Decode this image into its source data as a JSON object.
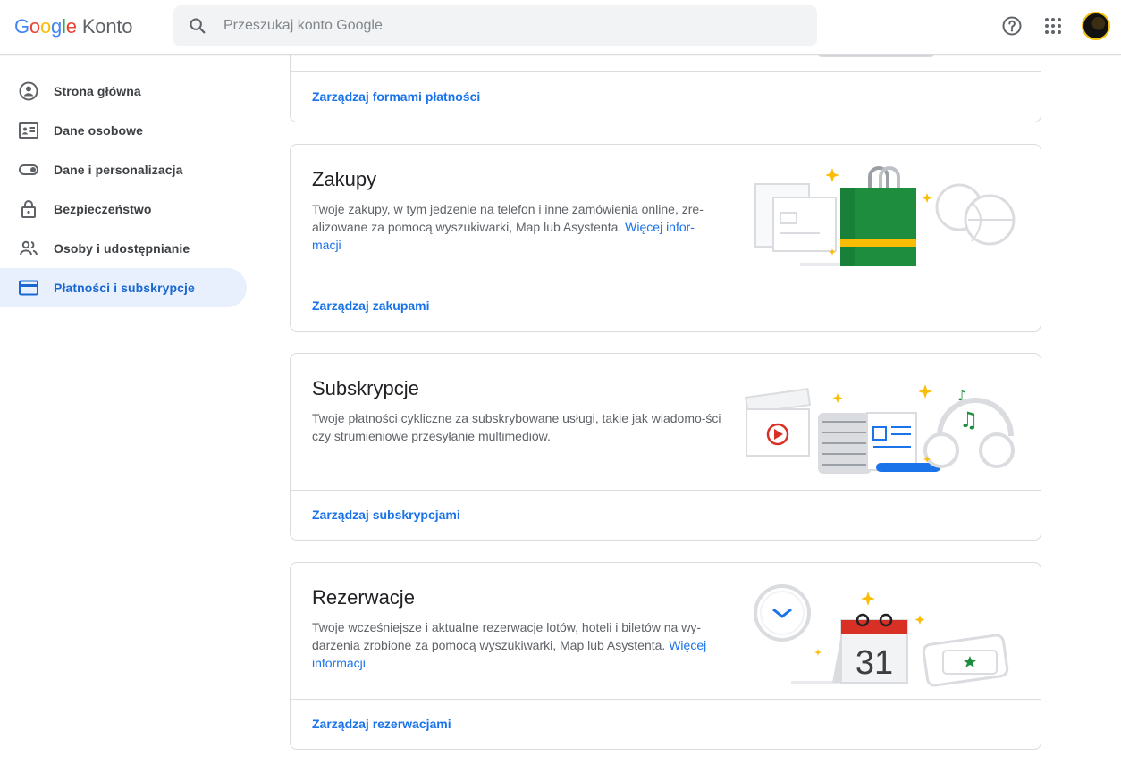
{
  "header": {
    "logo_letters": [
      "G",
      "o",
      "o",
      "g",
      "l",
      "e"
    ],
    "logo_suffix": "Konto",
    "search_placeholder": "Przeszukaj konto Google",
    "icons": [
      "search-icon",
      "help-icon",
      "apps-grid-icon",
      "avatar"
    ]
  },
  "sidebar": {
    "items": [
      {
        "label": "Strona główna",
        "icon": "account-circle-icon",
        "active": false
      },
      {
        "label": "Dane osobowe",
        "icon": "id-card-icon",
        "active": false
      },
      {
        "label": "Dane i personalizacja",
        "icon": "toggle-icon",
        "active": false
      },
      {
        "label": "Bezpieczeństwo",
        "icon": "lock-icon",
        "active": false
      },
      {
        "label": "Osoby i udostępnianie",
        "icon": "people-icon",
        "active": false
      },
      {
        "label": "Płatności i subskrypcje",
        "icon": "credit-card-icon",
        "active": true
      }
    ]
  },
  "main": {
    "payment_methods_link": "Zarządzaj formami płatności",
    "cards": [
      {
        "title": "Zakupy",
        "description": "Twoje zakupy, w tym jedzenie na telefon i inne zamówienia online, zre-alizowane za pomocą wyszukiwarki, Map lub Asystenta. ",
        "more": "Więcej infor-macji",
        "link": "Zarządzaj zakupami"
      },
      {
        "title": "Subskrypcje",
        "description": "Twoje płatności cykliczne za subskrybowane usługi, takie jak wiadomo-ści czy strumieniowe przesyłanie multimediów.",
        "more": "",
        "link": "Zarządzaj subskrypcjami"
      },
      {
        "title": "Rezerwacje",
        "description": "Twoje wcześniejsze i aktualne rezerwacje lotów, hoteli i biletów na wy-darzenia zrobione za pomocą wyszukiwarki, Map lub Asystenta. ",
        "more": "Więcej informacji",
        "link": "Zarządzaj rezerwacjami"
      }
    ],
    "calendar_day": "31"
  },
  "colors": {
    "accent": "#1a73e8",
    "active_bg": "#e8f0fe",
    "border": "#dadce0",
    "bag_green": "#1e8e3e",
    "bag_stripe": "#fbbc04",
    "calendar_red": "#d93025",
    "star_yellow": "#fbbc04"
  }
}
